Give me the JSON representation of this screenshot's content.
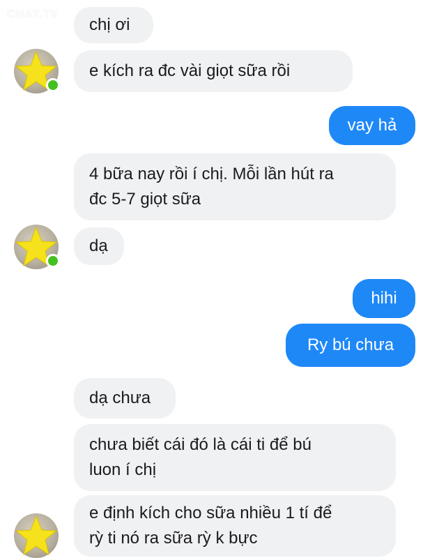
{
  "watermark": "CHAY.TV",
  "colors": {
    "incoming_bubble": "#f0f1f3",
    "outgoing_bubble": "#1e88f7",
    "online_indicator": "#44c021",
    "avatar_star": "#f5e11c"
  },
  "messages": [
    {
      "side": "incoming",
      "text": "chị ơi"
    },
    {
      "side": "incoming",
      "text": "e kích ra đc vài giọt sữa rồi"
    },
    {
      "side": "outgoing",
      "text": "vay hả"
    },
    {
      "side": "incoming",
      "text": "4 bữa nay rồi í chị. Mỗi lần hút ra\nđc 5-7 giọt sữa"
    },
    {
      "side": "incoming",
      "text": "dạ"
    },
    {
      "side": "outgoing",
      "text": "hihi"
    },
    {
      "side": "outgoing",
      "text": "Ry bú chưa"
    },
    {
      "side": "incoming",
      "text": "dạ chưa"
    },
    {
      "side": "incoming",
      "text": "chưa biết cái đó là cái ti để bú\nluon í chị"
    },
    {
      "side": "incoming",
      "text": "e định kích cho sữa nhiều 1 tí để\nrỳ ti nó ra sữa rỳ k bực"
    }
  ],
  "avatars": [
    {
      "icon": "star-avatar-icon",
      "online": true
    },
    {
      "icon": "star-avatar-icon",
      "online": true
    },
    {
      "icon": "star-avatar-icon",
      "online": false
    }
  ]
}
